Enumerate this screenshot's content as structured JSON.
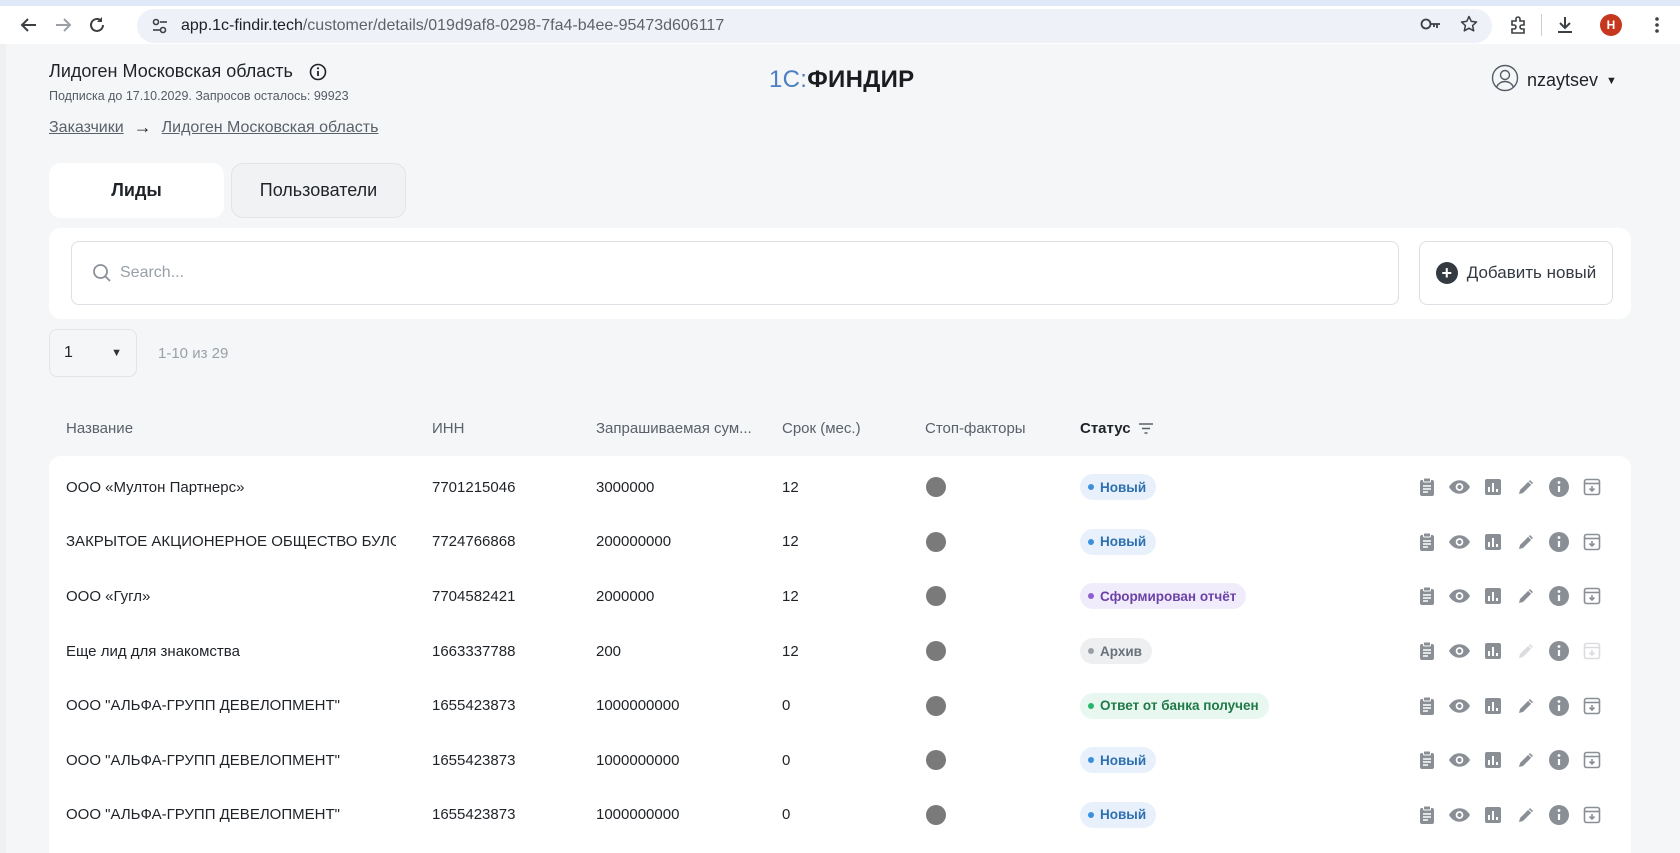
{
  "browser": {
    "url_host": "app.1c-findir.tech",
    "url_path": "/customer/details/019d9af8-0298-7fa4-b4ee-95473d606117",
    "profile_initial": "H"
  },
  "header": {
    "customer_name": "Лидоген Московская область",
    "subscription": "Подписка до 17.10.2029. Запросов осталось: 99923",
    "logo_prefix": "1С:",
    "logo_main": "ФИНДИР",
    "username": "nzaytsev"
  },
  "breadcrumb": {
    "items": [
      "Заказчики",
      "Лидоген Московская область"
    ],
    "separator": "→"
  },
  "tabs": [
    {
      "label": "Лиды",
      "active": true
    },
    {
      "label": "Пользователи",
      "active": false
    }
  ],
  "search": {
    "placeholder": "Search...",
    "value": ""
  },
  "add_button": {
    "label": "Добавить новый"
  },
  "pagination": {
    "page": "1",
    "range": "1-10 из 29"
  },
  "table": {
    "columns": [
      "Название",
      "ИНН",
      "Запрашиваемая сум...",
      "Срок (мес.)",
      "Стоп-факторы",
      "Статус"
    ],
    "rows": [
      {
        "name": "ООО «Мултон Партнерс»",
        "inn": "7701215046",
        "sum": "3000000",
        "term": "12",
        "status": "Новый",
        "status_kind": "new"
      },
      {
        "name": "ЗАКРЫТОЕ АКЦИОНЕРНОЕ ОБЩЕСТВО БУЛОЧ...",
        "inn": "7724766868",
        "sum": "200000000",
        "term": "12",
        "status": "Новый",
        "status_kind": "new"
      },
      {
        "name": "ООО «Гугл»",
        "inn": "7704582421",
        "sum": "2000000",
        "term": "12",
        "status": "Сформирован отчёт",
        "status_kind": "report"
      },
      {
        "name": "Еще лид для знакомства",
        "inn": "1663337788",
        "sum": "200",
        "term": "12",
        "status": "Архив",
        "status_kind": "archive"
      },
      {
        "name": "ООО \"АЛЬФА-ГРУПП ДЕВЕЛОПМЕНТ\"",
        "inn": "1655423873",
        "sum": "1000000000",
        "term": "0",
        "status": "Ответ от банка получен",
        "status_kind": "bank"
      },
      {
        "name": "ООО \"АЛЬФА-ГРУПП ДЕВЕЛОПМЕНТ\"",
        "inn": "1655423873",
        "sum": "1000000000",
        "term": "0",
        "status": "Новый",
        "status_kind": "new"
      },
      {
        "name": "ООО \"АЛЬФА-ГРУПП ДЕВЕЛОПМЕНТ\"",
        "inn": "1655423873",
        "sum": "1000000000",
        "term": "0",
        "status": "Новый",
        "status_kind": "new"
      }
    ],
    "row_actions": [
      "clipboard-icon",
      "eye-icon",
      "chart-icon",
      "pencil-icon",
      "info-icon",
      "archive-icon"
    ]
  },
  "colors": {
    "accent_blue": "#4a7fc1",
    "status_new": "#3c8fdc",
    "status_report": "#8d5fd0",
    "status_archive": "#9aa0a8",
    "status_bank": "#2bb36a"
  }
}
